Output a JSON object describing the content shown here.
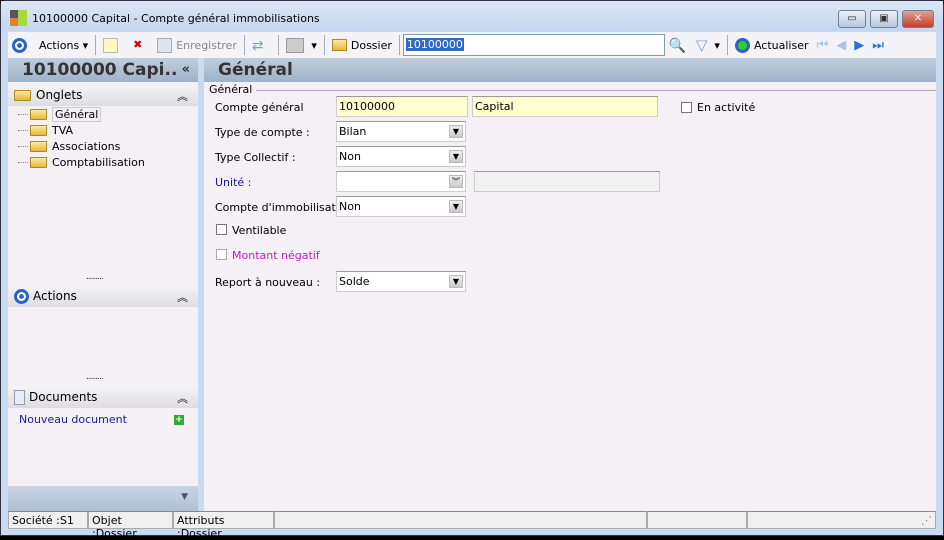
{
  "window": {
    "title": "10100000 Capital -  Compte général immobilisations",
    "minimize": "▭",
    "maximize": "▣",
    "close": "✕"
  },
  "toolbar": {
    "actions": "Actions",
    "save": "Enregistrer",
    "folder": "Dossier",
    "search_value": "10100000",
    "refresh": "Actualiser"
  },
  "left": {
    "header": "10100000 Capi..",
    "collapse": "«",
    "tabs_panel": {
      "title": "Onglets",
      "items": [
        "Général",
        "TVA",
        "Associations",
        "Comptabilisation"
      ]
    },
    "actions_panel": {
      "title": "Actions"
    },
    "documents_panel": {
      "title": "Documents",
      "new_doc": "Nouveau document"
    },
    "grip": "........."
  },
  "main": {
    "header": "Général",
    "group": "Général",
    "fields": {
      "compte_general": {
        "label": "Compte général",
        "value": "10100000",
        "name": "Capital"
      },
      "type_compte": {
        "label": "Type de compte :",
        "value": "Bilan"
      },
      "type_collectif": {
        "label": "Type Collectif :",
        "value": "Non"
      },
      "unite": {
        "label": "Unité :",
        "value": "",
        "extra": ""
      },
      "compte_immo": {
        "label": "Compte d'immobilisation :",
        "value": "Non"
      },
      "ventilable": {
        "label": "Ventilable",
        "checked": false
      },
      "montant_negatif": {
        "label": "Montant négatif",
        "checked": false
      },
      "report": {
        "label": "Report à nouveau :",
        "value": "Solde"
      },
      "en_activite": {
        "label": "En activité",
        "checked": false
      }
    }
  },
  "status": {
    "societe": "Société :S1",
    "objet": "Objet :Dossier",
    "attributs": "Attributs :Dossier"
  },
  "colors": {
    "unite_label": "#1a1a8c",
    "montant_label": "#c020c0",
    "link": "#1a1a8c",
    "field_yellow": "#ffffd0"
  }
}
